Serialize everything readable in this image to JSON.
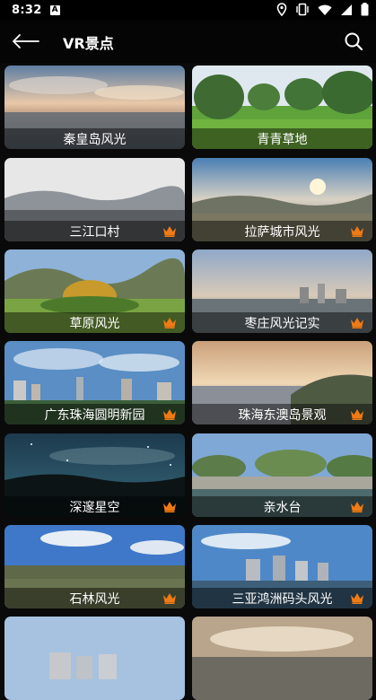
{
  "status": {
    "time": "8:32",
    "notif_letter": "A"
  },
  "header": {
    "title": "VR景点"
  },
  "colors": {
    "crown": "#f07a13",
    "background": "#0a0a0a"
  },
  "spots": [
    {
      "name": "秦皇岛风光",
      "premium": false
    },
    {
      "name": "青青草地",
      "premium": false
    },
    {
      "name": "三江口村",
      "premium": true
    },
    {
      "name": "拉萨城市风光",
      "premium": true
    },
    {
      "name": "草原风光",
      "premium": true
    },
    {
      "name": "枣庄风光记实",
      "premium": true
    },
    {
      "name": "广东珠海圆明新园",
      "premium": true
    },
    {
      "name": "珠海东澳岛景观",
      "premium": true
    },
    {
      "name": "深邃星空",
      "premium": true
    },
    {
      "name": "亲水台",
      "premium": true
    },
    {
      "name": "石林风光",
      "premium": true
    },
    {
      "name": "三亚鸿洲码头风光",
      "premium": true
    },
    {
      "name": "",
      "premium": false
    },
    {
      "name": "",
      "premium": false
    }
  ]
}
